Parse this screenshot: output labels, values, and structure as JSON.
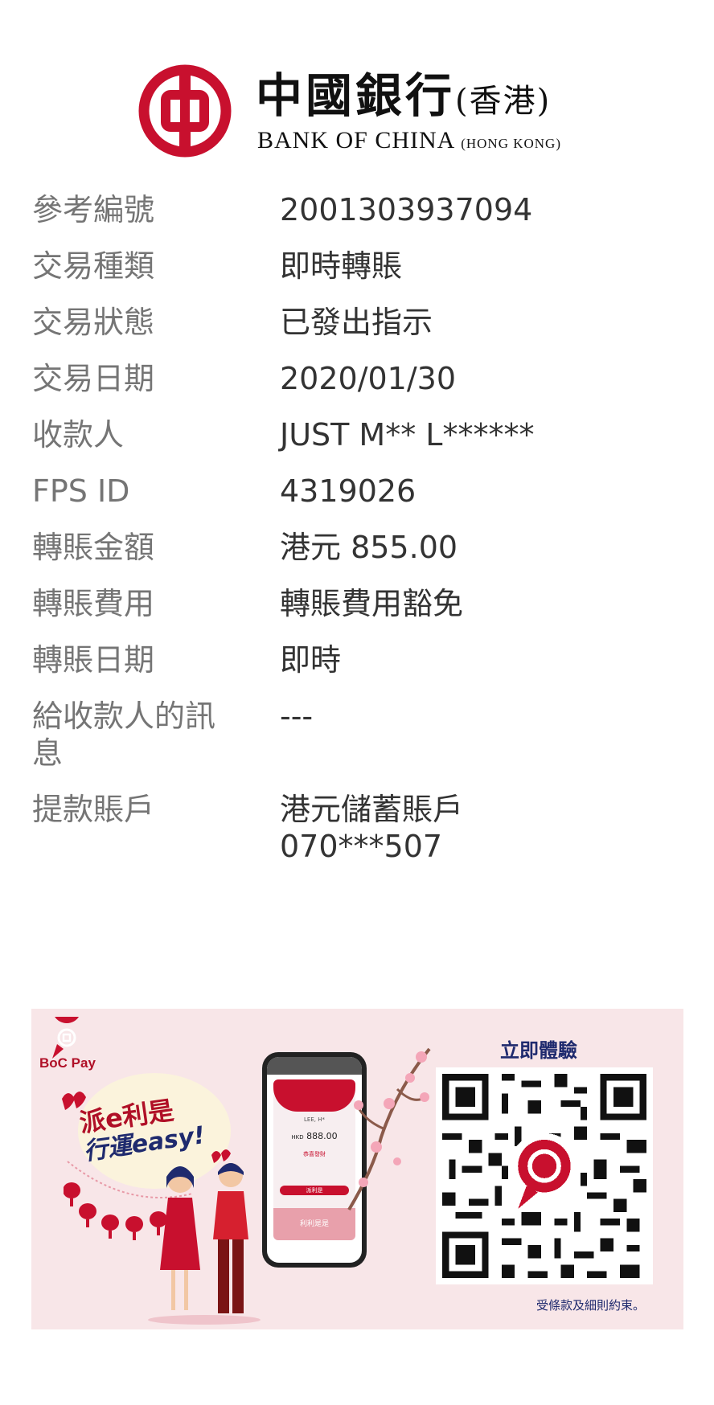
{
  "brand": {
    "name_cn": "中國銀行",
    "name_cn_suffix": "(香港)",
    "name_en": "BANK OF CHINA",
    "name_en_suffix": "(HONG KONG)",
    "color": "#c8102e"
  },
  "details": [
    {
      "label": "參考編號",
      "value": "2001303937094"
    },
    {
      "label": "交易種類",
      "value": "即時轉賬"
    },
    {
      "label": "交易狀態",
      "value": "已發出指示"
    },
    {
      "label": "交易日期",
      "value": "2020/01/30"
    },
    {
      "label": "收款人",
      "value": "JUST M** L******"
    },
    {
      "label": "FPS ID",
      "value": "4319026"
    },
    {
      "label": "轉賬金額",
      "value": "港元 855.00"
    },
    {
      "label": "轉賬費用",
      "value": "轉賬費用豁免"
    },
    {
      "label": "轉賬日期",
      "value": "即時"
    },
    {
      "label": "給收款人的訊息",
      "value": "---"
    },
    {
      "label": "提款賬戶",
      "value": "港元儲蓄賬戶",
      "value2": "070***507"
    }
  ],
  "promo": {
    "logo_text": "BoC Pay",
    "headline_1": "派e利是",
    "headline_2": "行運easy!",
    "phone": {
      "name": "LEE, H*",
      "amount_currency": "HKD",
      "amount": "888.00",
      "greeting": "恭喜發財",
      "button": "派利是",
      "footer": "利利是是"
    },
    "qr_title": "立即體驗",
    "terms": "受條款及細則約束。"
  }
}
